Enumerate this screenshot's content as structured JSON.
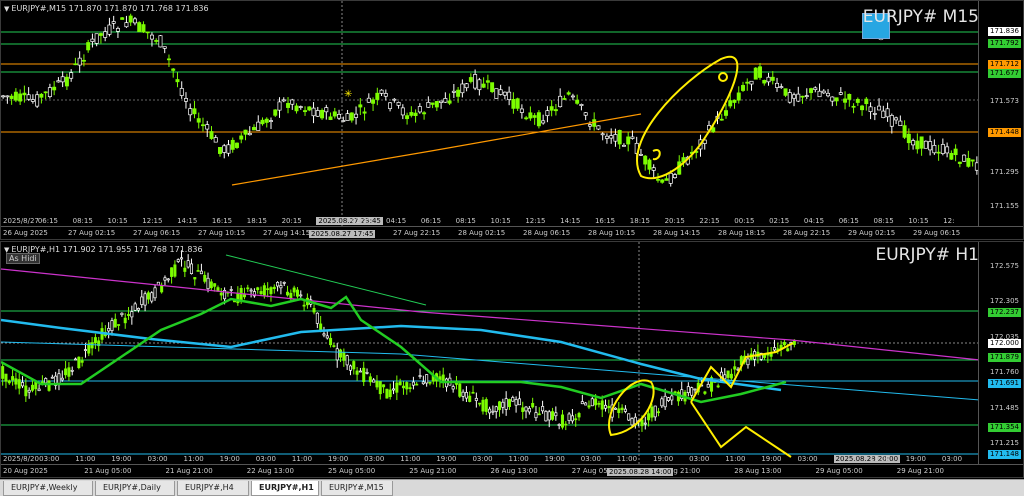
{
  "m15": {
    "header": "EURJPY#,M15  171.870 171.870 171.768 171.836",
    "symbol_label": "EURJPY# M15",
    "price_levels": [
      "171.836",
      "171.792",
      "171.712",
      "171.677",
      "171.573",
      "171.448",
      "171.295",
      "171.155"
    ],
    "time_labels": [
      "26 Aug 2025",
      "27 Aug 02:15",
      "27 Aug 06:15",
      "27 Aug 10:15",
      "27 Aug 14:15",
      "27 Aug 18:15",
      "27 Aug 22:15",
      "28 Aug 02:15",
      "28 Aug 06:15",
      "28 Aug 10:15",
      "28 Aug 14:15",
      "28 Aug 18:15",
      "28 Aug 22:15",
      "29 Aug 02:15",
      "29 Aug 06:15"
    ],
    "upper_time_labels": [
      "2025/8/27",
      "06:15",
      "08:15",
      "10:15",
      "12:15",
      "14:15",
      "16:15",
      "18:15",
      "20:15",
      "2025.08.27 23:45",
      "02:15",
      "04:15",
      "06:15",
      "08:15",
      "10:15",
      "12:15",
      "14:15",
      "16:15",
      "18:15",
      "20:15",
      "22:15",
      "00:15",
      "02:15",
      "04:15",
      "06:15",
      "08:15",
      "10:15",
      "12:"
    ],
    "cross_time": "2025.08.27 17:45"
  },
  "h1": {
    "header": "EURJPY#,H1  171.902 171.955 171.768 171.836",
    "as_hidi": "As Hidi",
    "symbol_label": "EURJPY# H1",
    "price_levels": [
      "172.575",
      "172.305",
      "172.237",
      "172.035",
      "172.000",
      "171.879",
      "171.760",
      "171.691",
      "171.485",
      "171.354",
      "171.215",
      "171.148"
    ],
    "time_labels": [
      "20 Aug 2025",
      "21 Aug 05:00",
      "21 Aug 21:00",
      "22 Aug 13:00",
      "25 Aug 05:00",
      "25 Aug 21:00",
      "26 Aug 13:00",
      "27 Aug 05:00",
      "27 Aug 21:00",
      "28 Aug 13:00",
      "29 Aug 05:00",
      "29 Aug 21:00"
    ],
    "upper_time_labels": [
      "2025/8/20",
      "03:00",
      "11:00",
      "19:00",
      "03:00",
      "11:00",
      "19:00",
      "03:00",
      "11:00",
      "19:00",
      "03:00",
      "11:00",
      "19:00",
      "03:00",
      "11:00",
      "19:00",
      "03:00",
      "11:00",
      "19:00",
      "03:00",
      "11:00",
      "19:00",
      "03:00",
      "2025.08.28 20:00",
      "11:00",
      "19:00",
      "03:00"
    ],
    "cross_time": "2025.08.28 14:00"
  },
  "tabs": [
    "EURJPY#,Weekly",
    "EURJPY#,Daily",
    "EURJPY#,H4",
    "EURJPY#,H1",
    "EURJPY#,M15"
  ],
  "active_tab": "EURJPY#,H1",
  "colors": {
    "bull": "#7CFC00",
    "bear": "#ffffff",
    "orange": "#ff9900",
    "magenta": "#cc33cc",
    "cyan": "#22bbee",
    "green": "#22cc22",
    "yellow": "#ffee00"
  }
}
